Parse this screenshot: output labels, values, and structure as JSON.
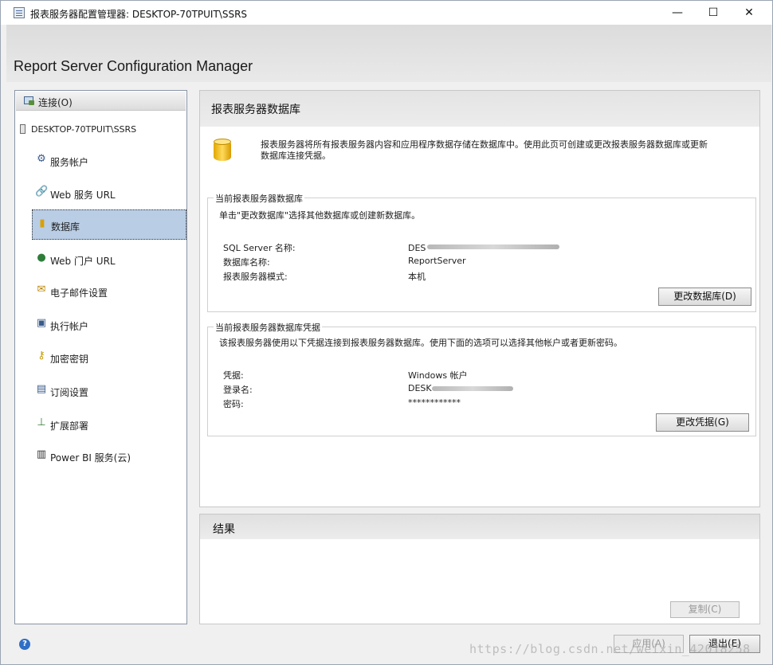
{
  "window": {
    "title": "报表服务器配置管理器: DESKTOP-70TPUIT\\SSRS",
    "minimize": "—",
    "maximize": "☐",
    "close": "✕"
  },
  "banner": {
    "title": "Report Server Configuration Manager"
  },
  "sidebar": {
    "connect": "连接(O)",
    "server": "DESKTOP-70TPUIT\\SSRS",
    "items": [
      {
        "label": "服务帐户",
        "icon": "service-account-icon"
      },
      {
        "label": "Web 服务 URL",
        "icon": "web-service-url-icon"
      },
      {
        "label": "数据库",
        "icon": "database-icon",
        "selected": true
      },
      {
        "label": "Web 门户 URL",
        "icon": "globe-icon"
      },
      {
        "label": "电子邮件设置",
        "icon": "email-icon"
      },
      {
        "label": "执行帐户",
        "icon": "execution-account-icon"
      },
      {
        "label": "加密密钥",
        "icon": "key-icon"
      },
      {
        "label": "订阅设置",
        "icon": "subscription-icon"
      },
      {
        "label": "扩展部署",
        "icon": "scale-out-icon"
      },
      {
        "label": "Power BI 服务(云)",
        "icon": "power-bi-icon"
      }
    ]
  },
  "main": {
    "title": "报表服务器数据库",
    "intro": "报表服务器将所有报表服务器内容和应用程序数据存储在数据库中。使用此页可创建或更改报表服务器数据库或更新数据库连接凭据。",
    "current_db": {
      "legend": "当前报表服务器数据库",
      "desc": "单击\"更改数据库\"选择其他数据库或创建新数据库。",
      "rows": [
        {
          "label": "SQL Server 名称:",
          "value": "DES"
        },
        {
          "label": "数据库名称:",
          "value": "ReportServer"
        },
        {
          "label": "报表服务器模式:",
          "value": "本机"
        }
      ],
      "button": "更改数据库(D)"
    },
    "credentials": {
      "legend": "当前报表服务器数据库凭据",
      "desc": "该报表服务器使用以下凭据连接到报表服务器数据库。使用下面的选项可以选择其他帐户或者更新密码。",
      "rows": [
        {
          "label": "凭据:",
          "value": "Windows 帐户"
        },
        {
          "label": "登录名:",
          "value": "DESK"
        },
        {
          "label": "密码:",
          "value": "************"
        }
      ],
      "button": "更改凭据(G)"
    }
  },
  "results": {
    "title": "结果",
    "copy": "复制(C)"
  },
  "footer": {
    "help": "?",
    "apply": "应用(A)",
    "exit": "退出(E)",
    "watermark": "https://blog.csdn.net/weixin_42018258"
  }
}
